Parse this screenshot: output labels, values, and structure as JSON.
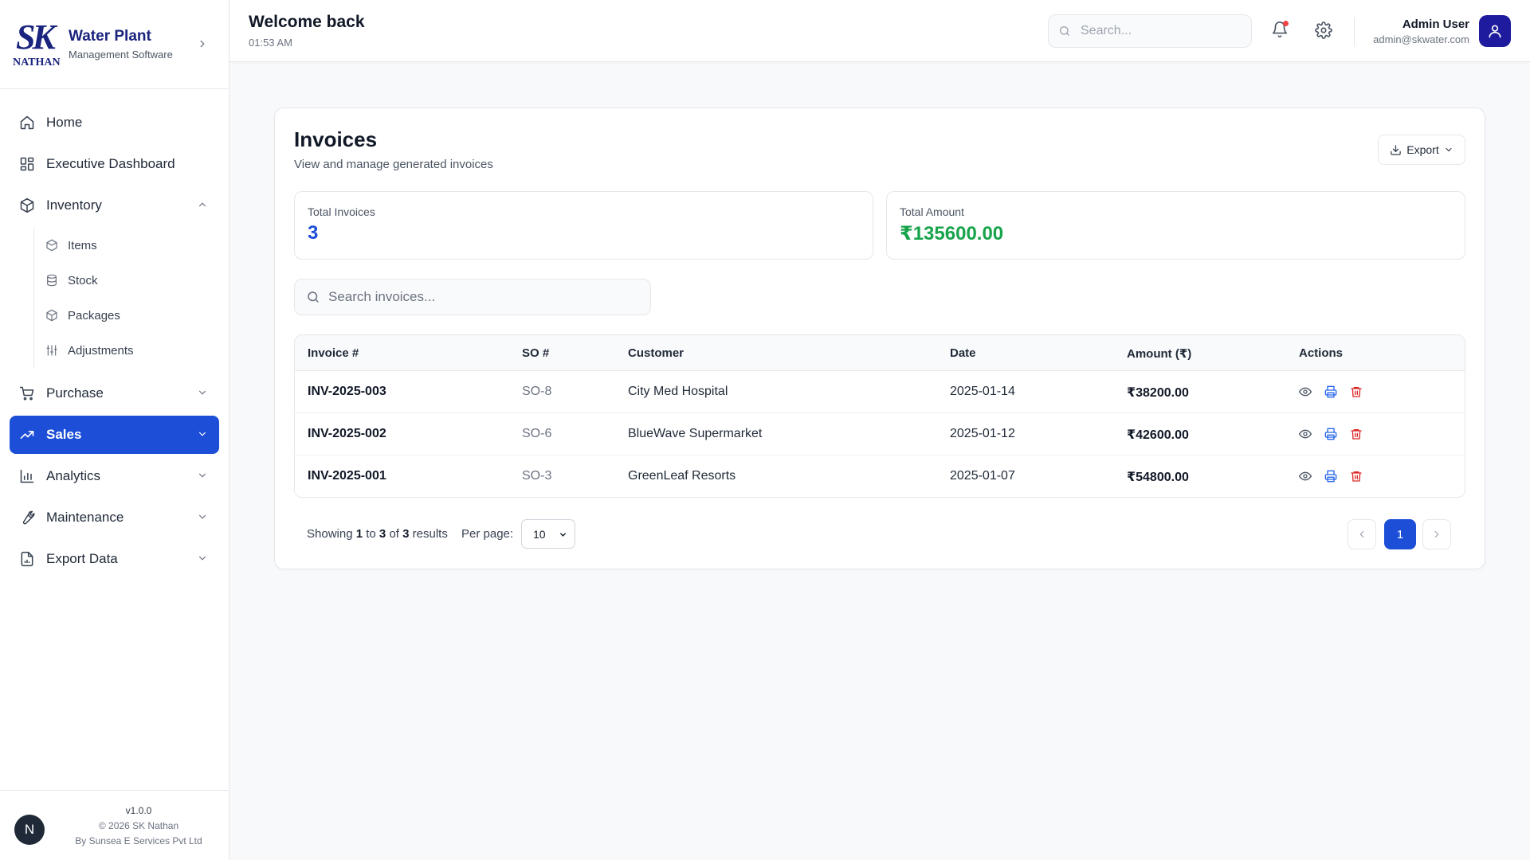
{
  "brand": {
    "logo_top": "SK",
    "logo_bottom": "NATHAN",
    "title": "Water Plant",
    "subtitle": "Management Software"
  },
  "nav": {
    "home": "Home",
    "executive_dashboard": "Executive Dashboard",
    "inventory": "Inventory",
    "inventory_items": [
      "Items",
      "Stock",
      "Packages",
      "Adjustments"
    ],
    "purchase": "Purchase",
    "sales": "Sales",
    "analytics": "Analytics",
    "maintenance": "Maintenance",
    "export_data": "Export Data"
  },
  "footer": {
    "avatar": "N",
    "version": "v1.0.0",
    "copyright": "© 2026 SK Nathan",
    "company": "By Sunsea E Services Pvt Ltd"
  },
  "header": {
    "welcome": "Welcome back",
    "time": "01:53 AM",
    "search_placeholder": "Search...",
    "user_name": "Admin User",
    "user_email": "admin@skwater.com"
  },
  "page": {
    "title": "Invoices",
    "subtitle": "View and manage generated invoices",
    "export_label": "Export",
    "stats": [
      {
        "label": "Total Invoices",
        "value": "3"
      },
      {
        "label": "Total Amount",
        "value": "₹135600.00"
      }
    ],
    "search_placeholder": "Search invoices..."
  },
  "table": {
    "columns": [
      "Invoice #",
      "SO #",
      "Customer",
      "Date",
      "Amount (₹)",
      "Actions"
    ],
    "rows": [
      {
        "invoice": "INV-2025-003",
        "so": "SO-8",
        "customer": "City Med Hospital",
        "date": "2025-01-14",
        "amount": "₹38200.00"
      },
      {
        "invoice": "INV-2025-002",
        "so": "SO-6",
        "customer": "BlueWave Supermarket",
        "date": "2025-01-12",
        "amount": "₹42600.00"
      },
      {
        "invoice": "INV-2025-001",
        "so": "SO-3",
        "customer": "GreenLeaf Resorts",
        "date": "2025-01-07",
        "amount": "₹54800.00"
      }
    ]
  },
  "pagination": {
    "showing": "Showing",
    "from": "1",
    "to_word": "to",
    "to": "3",
    "of_word": "of",
    "total": "3",
    "results_word": "results",
    "per_page_label": "Per page:",
    "per_page_value": "10",
    "current_page": "1"
  },
  "colors": {
    "primary": "#1d4ed8",
    "brand_navy": "#1a237e",
    "success": "#16a34a",
    "danger": "#dc2626"
  }
}
